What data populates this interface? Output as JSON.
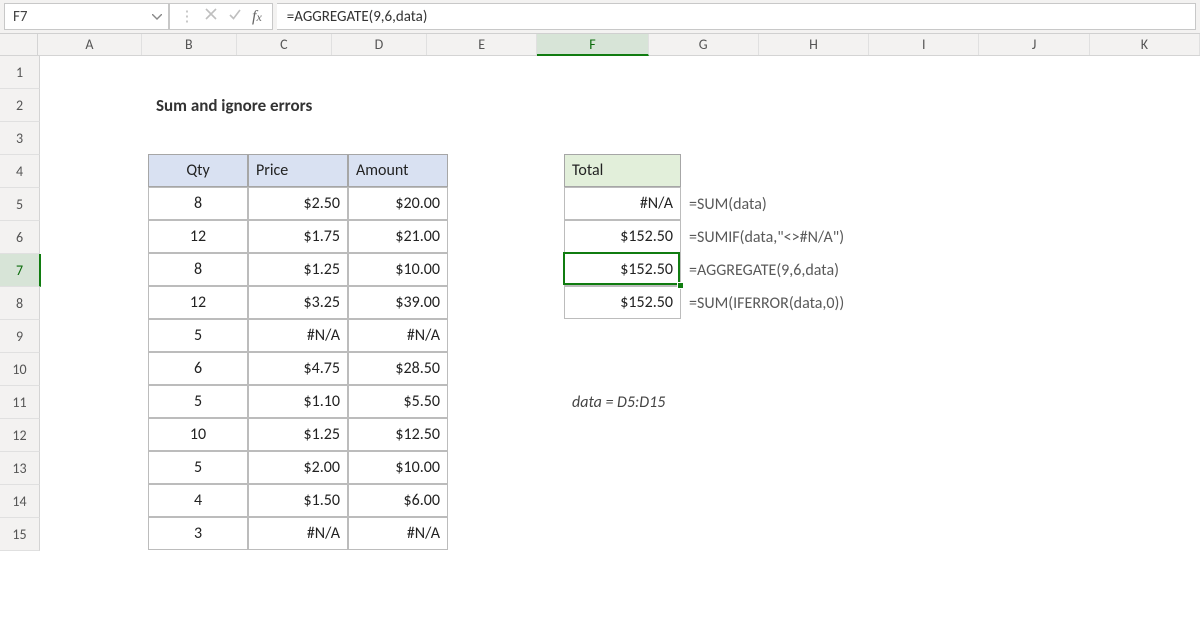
{
  "name_box": "F7",
  "formula": "=AGGREGATE(9,6,data)",
  "columns": [
    "A",
    "B",
    "C",
    "D",
    "E",
    "F",
    "G",
    "H",
    "I",
    "J",
    "K"
  ],
  "rows": [
    "1",
    "2",
    "3",
    "4",
    "5",
    "6",
    "7",
    "8",
    "9",
    "10",
    "11",
    "12",
    "13",
    "14",
    "15"
  ],
  "selected_col": "F",
  "selected_row": "7",
  "title": "Sum and ignore errors",
  "table": {
    "headers": {
      "qty": "Qty",
      "price": "Price",
      "amount": "Amount"
    },
    "rows": [
      {
        "qty": "8",
        "price": "$2.50",
        "amount": "$20.00"
      },
      {
        "qty": "12",
        "price": "$1.75",
        "amount": "$21.00"
      },
      {
        "qty": "8",
        "price": "$1.25",
        "amount": "$10.00"
      },
      {
        "qty": "12",
        "price": "$3.25",
        "amount": "$39.00"
      },
      {
        "qty": "5",
        "price": "#N/A",
        "amount": "#N/A"
      },
      {
        "qty": "6",
        "price": "$4.75",
        "amount": "$28.50"
      },
      {
        "qty": "5",
        "price": "$1.10",
        "amount": "$5.50"
      },
      {
        "qty": "10",
        "price": "$1.25",
        "amount": "$12.50"
      },
      {
        "qty": "5",
        "price": "$2.00",
        "amount": "$10.00"
      },
      {
        "qty": "4",
        "price": "$1.50",
        "amount": "$6.00"
      },
      {
        "qty": "3",
        "price": "#N/A",
        "amount": "#N/A"
      }
    ]
  },
  "totals": {
    "header": "Total",
    "rows": [
      {
        "value": "#N/A",
        "formula": "=SUM(data)"
      },
      {
        "value": "$152.50",
        "formula": "=SUMIF(data,\"<>#N/A\")"
      },
      {
        "value": "$152.50",
        "formula": "=AGGREGATE(9,6,data)"
      },
      {
        "value": "$152.50",
        "formula": "=SUM(IFERROR(data,0))"
      }
    ]
  },
  "note": "data = D5:D15",
  "chart_data": {
    "type": "table",
    "title": "Sum and ignore errors",
    "columns": [
      "Qty",
      "Price",
      "Amount"
    ],
    "rows": [
      [
        8,
        2.5,
        20.0
      ],
      [
        12,
        1.75,
        21.0
      ],
      [
        8,
        1.25,
        10.0
      ],
      [
        12,
        3.25,
        39.0
      ],
      [
        5,
        null,
        null
      ],
      [
        6,
        4.75,
        28.5
      ],
      [
        5,
        1.1,
        5.5
      ],
      [
        10,
        1.25,
        12.5
      ],
      [
        5,
        2.0,
        10.0
      ],
      [
        4,
        1.5,
        6.0
      ],
      [
        3,
        null,
        null
      ]
    ],
    "totals": [
      {
        "label": "SUM(data)",
        "value": null
      },
      {
        "label": "SUMIF(data,\"<>#N/A\")",
        "value": 152.5
      },
      {
        "label": "AGGREGATE(9,6,data)",
        "value": 152.5
      },
      {
        "label": "SUM(IFERROR(data,0))",
        "value": 152.5
      }
    ],
    "named_range": "data = D5:D15"
  }
}
